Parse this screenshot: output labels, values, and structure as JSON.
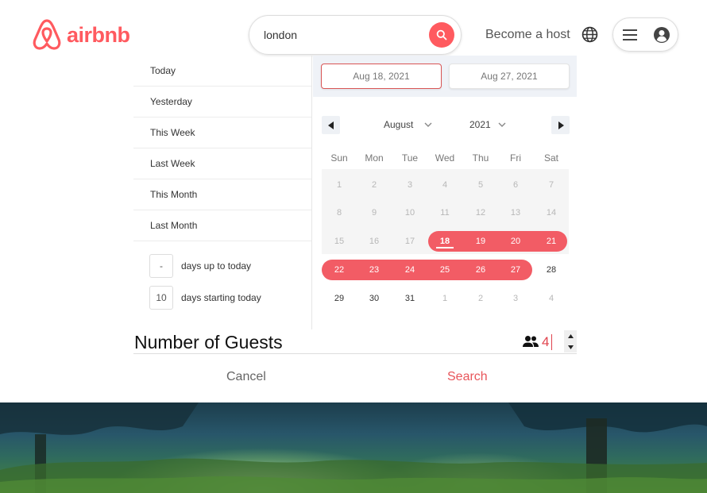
{
  "header": {
    "brand": "airbnb",
    "search_value": "london",
    "host_link": "Become a host",
    "icons": {
      "logo": "airbnb-logo-icon",
      "search": "search-icon",
      "globe": "globe-icon",
      "menu": "hamburger-menu-icon",
      "avatar": "user-avatar-icon"
    }
  },
  "colors": {
    "brand": "#FF5A5F",
    "range": "#f25c65",
    "date_band": "#eff2f7"
  },
  "presets": {
    "items": [
      "Today",
      "Yesterday",
      "This Week",
      "Last Week",
      "This Month",
      "Last Month"
    ],
    "up_to_today": {
      "value": "-",
      "label": "days up to today"
    },
    "starting_today": {
      "value": "10",
      "label": "days starting today"
    }
  },
  "date_range": {
    "start": "Aug 18, 2021",
    "end": "Aug 27, 2021"
  },
  "calendar": {
    "month": "August",
    "year": "2021",
    "weekdays": [
      "Sun",
      "Mon",
      "Tue",
      "Wed",
      "Thu",
      "Fri",
      "Sat"
    ],
    "weeks": [
      [
        "1",
        "2",
        "3",
        "4",
        "5",
        "6",
        "7"
      ],
      [
        "8",
        "9",
        "10",
        "11",
        "12",
        "13",
        "14"
      ],
      [
        "15",
        "16",
        "17",
        "18",
        "19",
        "20",
        "21"
      ],
      [
        "22",
        "23",
        "24",
        "25",
        "26",
        "27",
        "28"
      ],
      [
        "29",
        "30",
        "31",
        "1",
        "2",
        "3",
        "4"
      ]
    ],
    "selected_start_day": 18,
    "selected_end_day": 27
  },
  "guests": {
    "title": "Number of Guests",
    "value": "4",
    "icon": "people-icon"
  },
  "actions": {
    "cancel": "Cancel",
    "search": "Search"
  }
}
